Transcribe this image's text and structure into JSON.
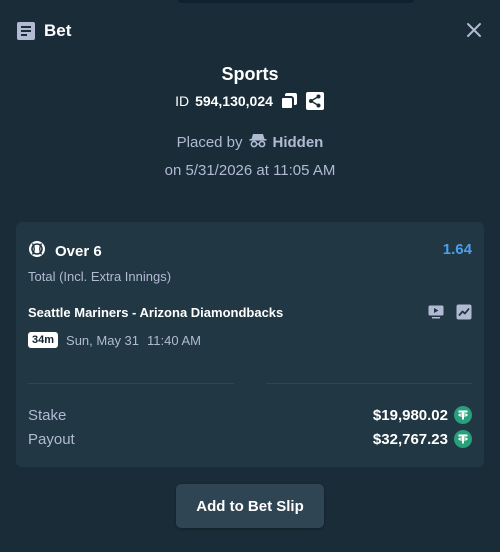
{
  "header": {
    "title": "Bet",
    "icon": "bet-slip-icon",
    "close_icon": "close-icon"
  },
  "bet": {
    "sport": "Sports",
    "id_label": "ID",
    "id_number": "594,130,024",
    "placed_by_label": "Placed by",
    "placed_by_user": "Hidden",
    "placed_on": "on 5/31/2026 at 11:05 AM"
  },
  "selection": {
    "icon": "baseball-icon",
    "name": "Over 6",
    "odds": "1.64",
    "market": "Total (Incl. Extra Innings)",
    "match": "Seattle Mariners - Arizona Diamondbacks",
    "time_badge": "34m",
    "date": "Sun, May 31",
    "time": "11:40 AM"
  },
  "summary": {
    "stake_label": "Stake",
    "stake_value": "$19,980.02",
    "payout_label": "Payout",
    "payout_value": "$32,767.23",
    "currency_icon": "tether-icon",
    "currency_color": "#26a17b"
  },
  "actions": {
    "add_to_slip": "Add to Bet Slip"
  },
  "colors": {
    "background": "#1a2c38",
    "card": "#213743",
    "accent": "#4d9fec",
    "muted": "#b1bad3"
  }
}
